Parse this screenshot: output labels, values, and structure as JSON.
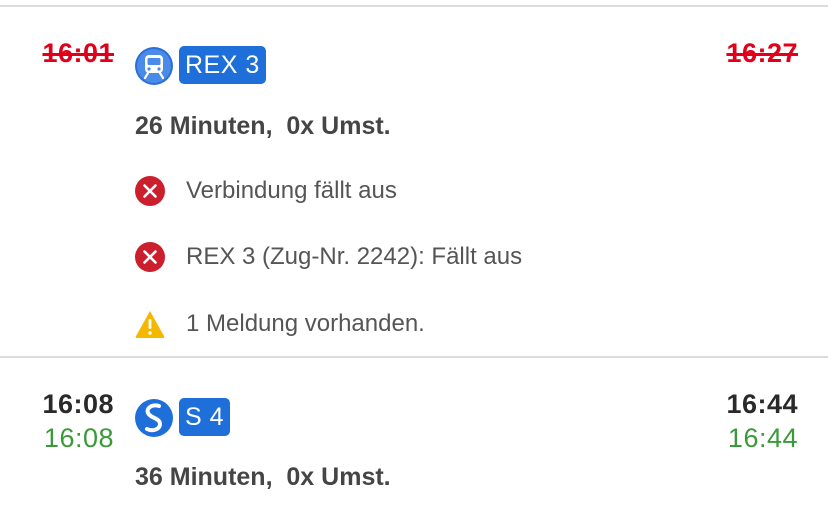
{
  "connection_1": {
    "departure_planned": "16:01",
    "arrival_planned": "16:27",
    "line": "REX 3",
    "line_icon": "train-icon",
    "summary": "26 Minuten,  0x Umst.",
    "notices": [
      {
        "icon": "error-icon",
        "text": "Verbindung fällt aus"
      },
      {
        "icon": "error-icon",
        "text": "REX 3 (Zug-Nr. 2242): Fällt aus"
      },
      {
        "icon": "warning-icon",
        "text": "1 Meldung vorhanden."
      }
    ]
  },
  "connection_2": {
    "departure_planned": "16:08",
    "departure_realtime": "16:08",
    "arrival_planned": "16:44",
    "arrival_realtime": "16:44",
    "line": "S 4",
    "line_icon": "s-bahn-icon",
    "summary": "36 Minuten,  0x Umst."
  },
  "colors": {
    "cancelled": "#e0001b",
    "realtime": "#3a9a3a",
    "line_badge": "#1e6fd9",
    "error_icon": "#cc1f2e",
    "warning_icon": "#f5b800"
  }
}
